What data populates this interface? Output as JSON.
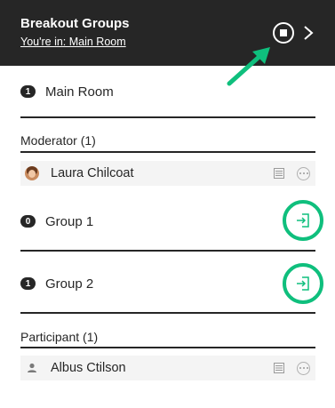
{
  "header": {
    "title": "Breakout Groups",
    "subtitle": "You're in: Main Room",
    "stop_icon": "stop-circle-icon",
    "collapse_icon": "chevron-right-icon"
  },
  "colors": {
    "header_bg": "#262626",
    "highlight": "#0fbf7d",
    "row_bg": "#f4f4f4"
  },
  "main_room": {
    "count": "1",
    "name": "Main Room"
  },
  "moderator_section": {
    "label": "Moderator (1)",
    "users": [
      {
        "name": "Laura Chilcoat",
        "avatar": "photo"
      }
    ]
  },
  "groups": [
    {
      "count": "0",
      "name": "Group 1",
      "join_icon": "join-group-icon"
    },
    {
      "count": "1",
      "name": "Group 2",
      "join_icon": "join-group-icon"
    }
  ],
  "participant_section": {
    "label": "Participant (1)",
    "users": [
      {
        "name": "Albus Ctilson",
        "avatar": "generic-user"
      }
    ]
  }
}
